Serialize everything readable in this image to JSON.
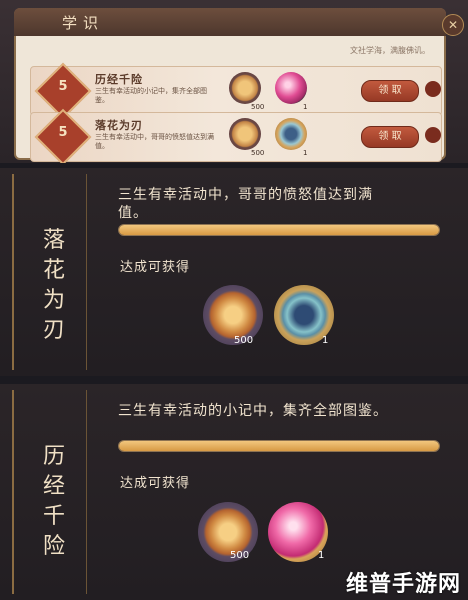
{
  "window": {
    "tab": "学识",
    "close": "✕",
    "hint": "文社学海，满腹佛讥。"
  },
  "rows": [
    {
      "num": "5",
      "name": "历经千险",
      "desc": "三生有幸活动的小记中，集齐全部图鉴。",
      "coin_count": "500",
      "item_count": "1",
      "claim": "领 取"
    },
    {
      "num": "5",
      "name": "落花为刃",
      "desc": "三生有幸活动中，哥哥的愤怒值达到满值。",
      "coin_count": "500",
      "item_count": "1",
      "claim": "领 取"
    }
  ],
  "detail1": {
    "title": "落花为刃",
    "desc": "三生有幸活动中，哥哥的愤怒值达到满值。",
    "progress": 1.0,
    "reward_label": "达成可获得",
    "coin_count": "500",
    "item_count": "1"
  },
  "detail2": {
    "title": "历经千险",
    "desc": "三生有幸活动的小记中，集齐全部图鉴。",
    "progress": 1.0,
    "reward_label": "达成可获得",
    "coin_count": "500",
    "item_count": "1"
  },
  "watermark": "维普手游网",
  "colors": {
    "accent": "#d79a44",
    "claim": "#b04a30"
  }
}
